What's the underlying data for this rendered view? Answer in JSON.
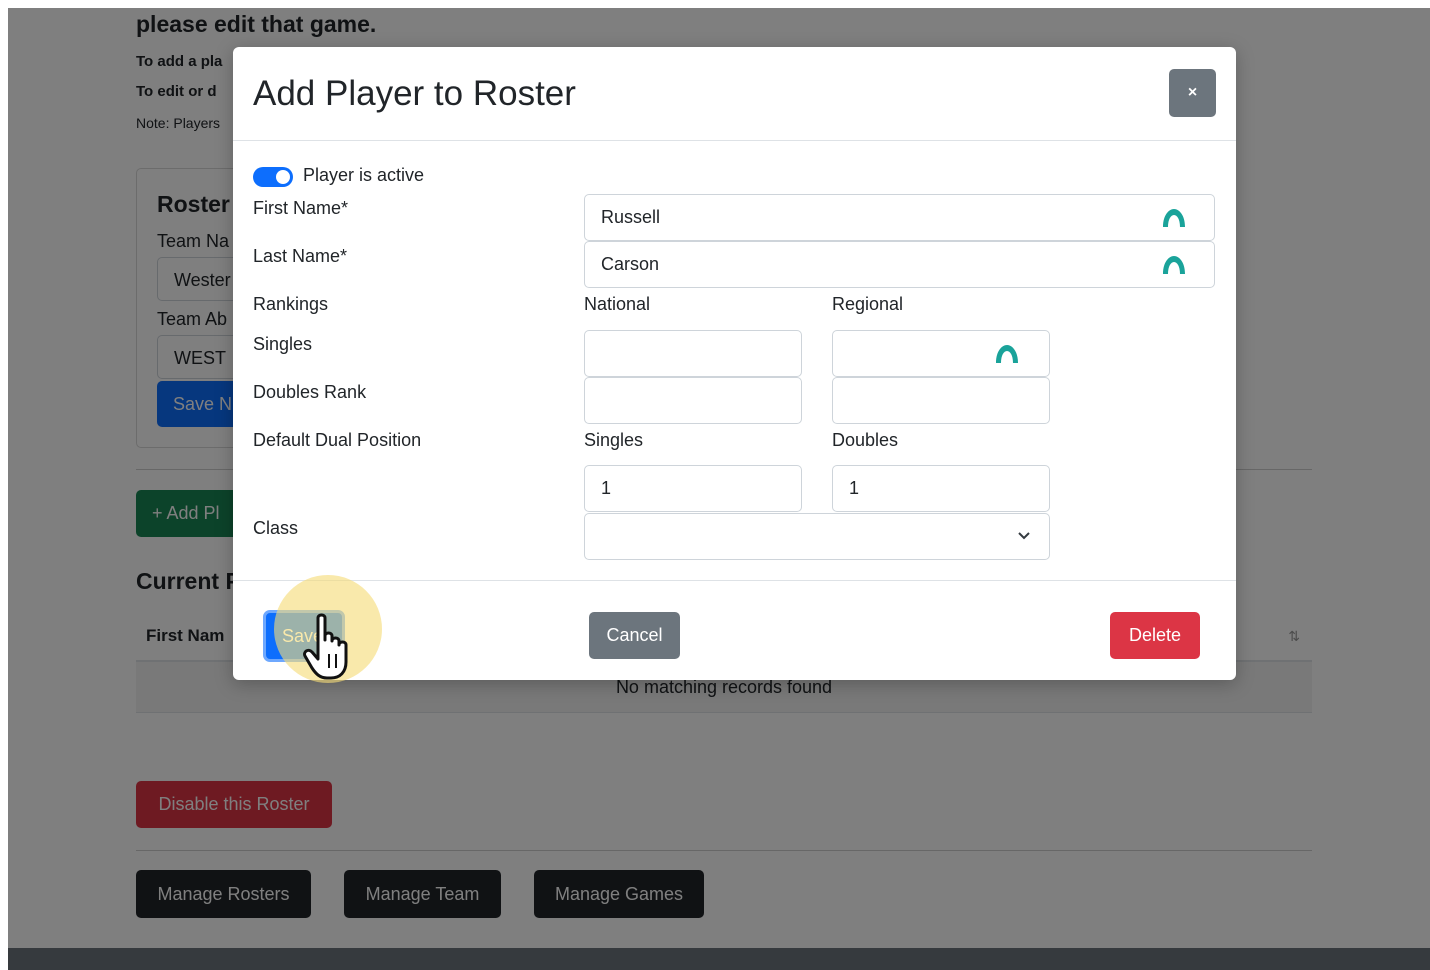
{
  "background_page": {
    "heading": "please edit that game.",
    "instruction_1": "To add a pla",
    "instruction_2": "To edit or d",
    "note": "Note: Players",
    "roster_card": {
      "title": "Roster",
      "team_name_label": "Team Na",
      "team_name_value": "Wester",
      "team_abbr_label": "Team Ab",
      "team_abbr_value": "WEST",
      "save_button": "Save N"
    },
    "add_player_button": "+ Add Pl",
    "current_section_title": "Current P",
    "table": {
      "first_name_header": "First Nam",
      "sort_icon": "⇅",
      "empty_message": "No matching records found"
    },
    "disable_button": "Disable this Roster",
    "manage_buttons": [
      "Manage Rosters",
      "Manage Team",
      "Manage Games"
    ]
  },
  "modal": {
    "title": "Add Player to Roster",
    "close_label": "×",
    "active_toggle": {
      "label": "Player is active",
      "checked": true
    },
    "first_name": {
      "label": "First Name*",
      "value": "Russell"
    },
    "last_name": {
      "label": "Last Name*",
      "value": "Carson"
    },
    "rankings": {
      "label": "Rankings",
      "national_header": "National",
      "regional_header": "Regional",
      "singles_label": "Singles",
      "doubles_label": "Doubles Rank",
      "singles_national": "",
      "singles_regional": "",
      "doubles_national": "",
      "doubles_regional": ""
    },
    "default_dual_position": {
      "label": "Default Dual Position",
      "singles_header": "Singles",
      "doubles_header": "Doubles",
      "singles_value": "1",
      "doubles_value": "1"
    },
    "class_field": {
      "label": "Class",
      "value": ""
    },
    "buttons": {
      "save": "Save",
      "cancel": "Cancel",
      "delete": "Delete"
    }
  },
  "colors": {
    "primary": "#0d6efd",
    "secondary": "#6c757d",
    "success": "#198754",
    "danger": "#dc3545",
    "dark": "#212529",
    "extension_icon": "#1aa39a",
    "click_highlight": "#f5dc78"
  },
  "icons": {
    "close": "close-icon",
    "extension": "password-manager-icon",
    "select": "chevron-down-icon",
    "cursor": "hand-pointer-icon",
    "sort": "sort-icon"
  }
}
